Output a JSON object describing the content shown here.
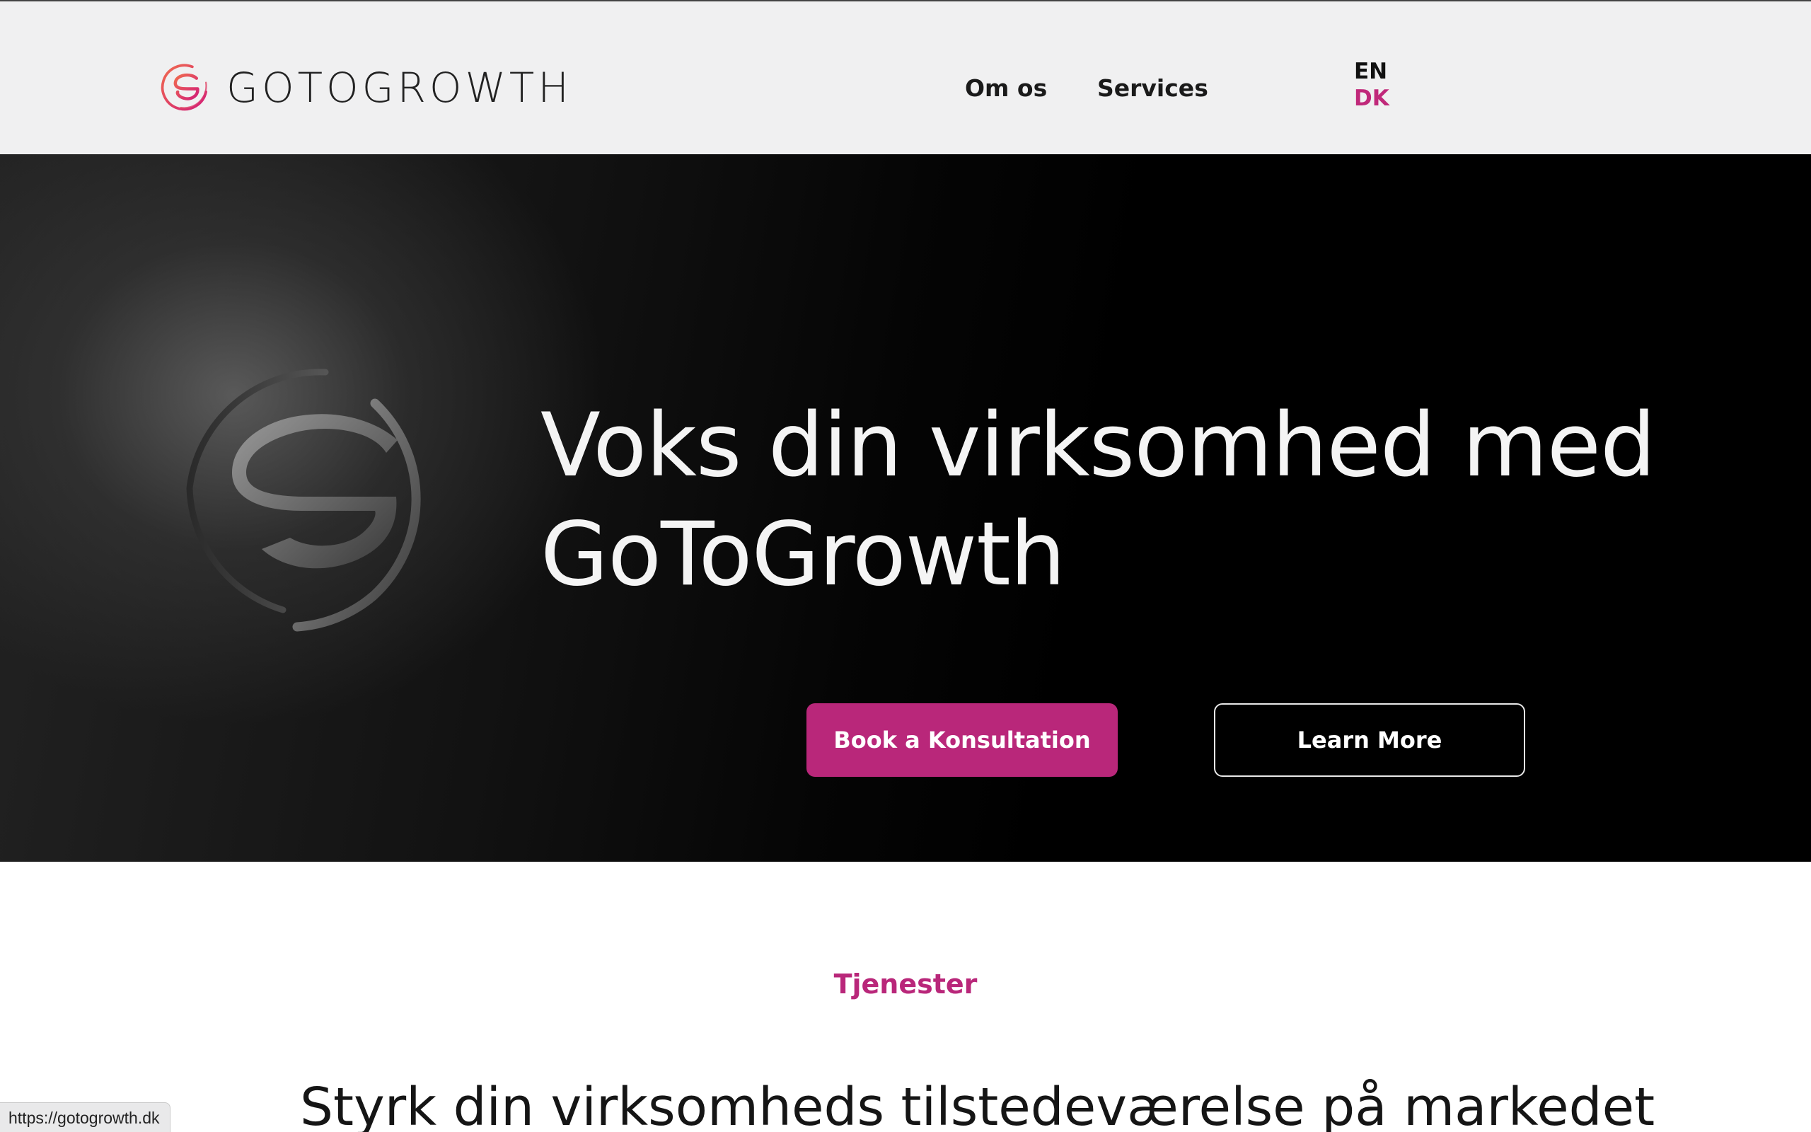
{
  "header": {
    "logo_text": "GOTOGROWTH",
    "nav": [
      {
        "label": "Om os"
      },
      {
        "label": "Services"
      }
    ],
    "languages": {
      "en": "EN",
      "dk": "DK",
      "active": "DK"
    }
  },
  "hero": {
    "title": "Voks din virksomhed med GoToGrowth",
    "primary_button": "Book a Konsultation",
    "secondary_button": "Learn More"
  },
  "services": {
    "tag": "Tjenester",
    "title": "Styrk din virksomheds tilstedeværelse på markedet"
  },
  "status_bar": {
    "url": "https://gotogrowth.dk"
  },
  "colors": {
    "accent": "#b9277a",
    "logo_gradient_start": "#f06b4f",
    "logo_gradient_end": "#d21e77",
    "header_bg": "#f0f0f1",
    "hero_bg": "#000000"
  }
}
